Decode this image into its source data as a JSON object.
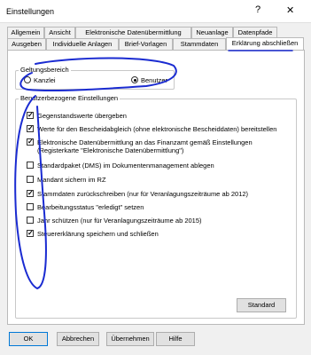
{
  "window": {
    "title": "Einstellungen",
    "help": "?",
    "close": "✕"
  },
  "tabs_row1": [
    "Allgemein",
    "Ansicht",
    "Elektronische Datenübermittlung",
    "Neuanlage",
    "Datenpfade"
  ],
  "tabs_row2": [
    "Ausgeben",
    "Individuelle Anlagen",
    "Brief-Vorlagen",
    "Stammdaten",
    "Erklärung abschließen"
  ],
  "active_tab": "Erklärung abschließen",
  "geltungsbereich": {
    "legend": "Geltungsbereich",
    "options": [
      {
        "label": "Kanzlei",
        "selected": false
      },
      {
        "label": "Benutzer",
        "selected": true
      }
    ]
  },
  "benutzer_einstellungen": {
    "legend": "Benutzerbezogene Einstellungen",
    "items": [
      {
        "label": "Gegenstandswerte übergeben",
        "checked": true
      },
      {
        "label": "Werte für den Bescheidabgleich (ohne elektronische Bescheiddaten) bereitstellen",
        "checked": true
      },
      {
        "label": "Elektronische Datenübermittlung an das Finanzamt gemäß Einstellungen",
        "label2": "(Registerkarte \"Elektronische Datenübermittlung\")",
        "checked": true
      },
      {
        "label": "Standardpaket (DMS) im Dokumentenmanagement ablegen",
        "checked": false
      },
      {
        "label": "Mandant sichern im RZ",
        "checked": false
      },
      {
        "label": "Stammdaten zurückschreiben (nur für Veranlagungszeiträume ab 2012)",
        "checked": true
      },
      {
        "label": "Bearbeitungsstatus \"erledigt\" setzen",
        "checked": false
      },
      {
        "label": "Jahr schützen (nur für Veranlagungszeiträume ab 2015)",
        "checked": false
      },
      {
        "label": "Steuererklärung speichern und schließen",
        "checked": true
      }
    ],
    "standard_button": "Standard"
  },
  "footer": {
    "ok": "OK",
    "cancel": "Abbrechen",
    "apply": "Übernehmen",
    "help": "Hilfe"
  },
  "annotation_color": "#1a2bd1"
}
